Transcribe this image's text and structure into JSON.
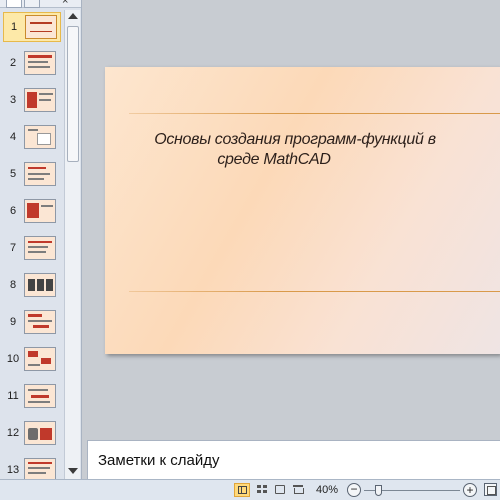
{
  "thumbnails": {
    "selected": 1,
    "items": [
      {
        "number": "1"
      },
      {
        "number": "2"
      },
      {
        "number": "3"
      },
      {
        "number": "4"
      },
      {
        "number": "5"
      },
      {
        "number": "6"
      },
      {
        "number": "7"
      },
      {
        "number": "8"
      },
      {
        "number": "9"
      },
      {
        "number": "10"
      },
      {
        "number": "11"
      },
      {
        "number": "12"
      },
      {
        "number": "13"
      }
    ]
  },
  "pane_tabs": {
    "close_glyph": "×"
  },
  "slide": {
    "title_line1": "Основы создания программ-функций в",
    "title_line2": "среде MathCAD"
  },
  "notes": {
    "placeholder": "Заметки к слайду"
  },
  "status_bar": {
    "zoom": "40%",
    "zoom_out_glyph": "−",
    "zoom_in_glyph": "+",
    "zoom_level_fraction": 0.15
  }
}
